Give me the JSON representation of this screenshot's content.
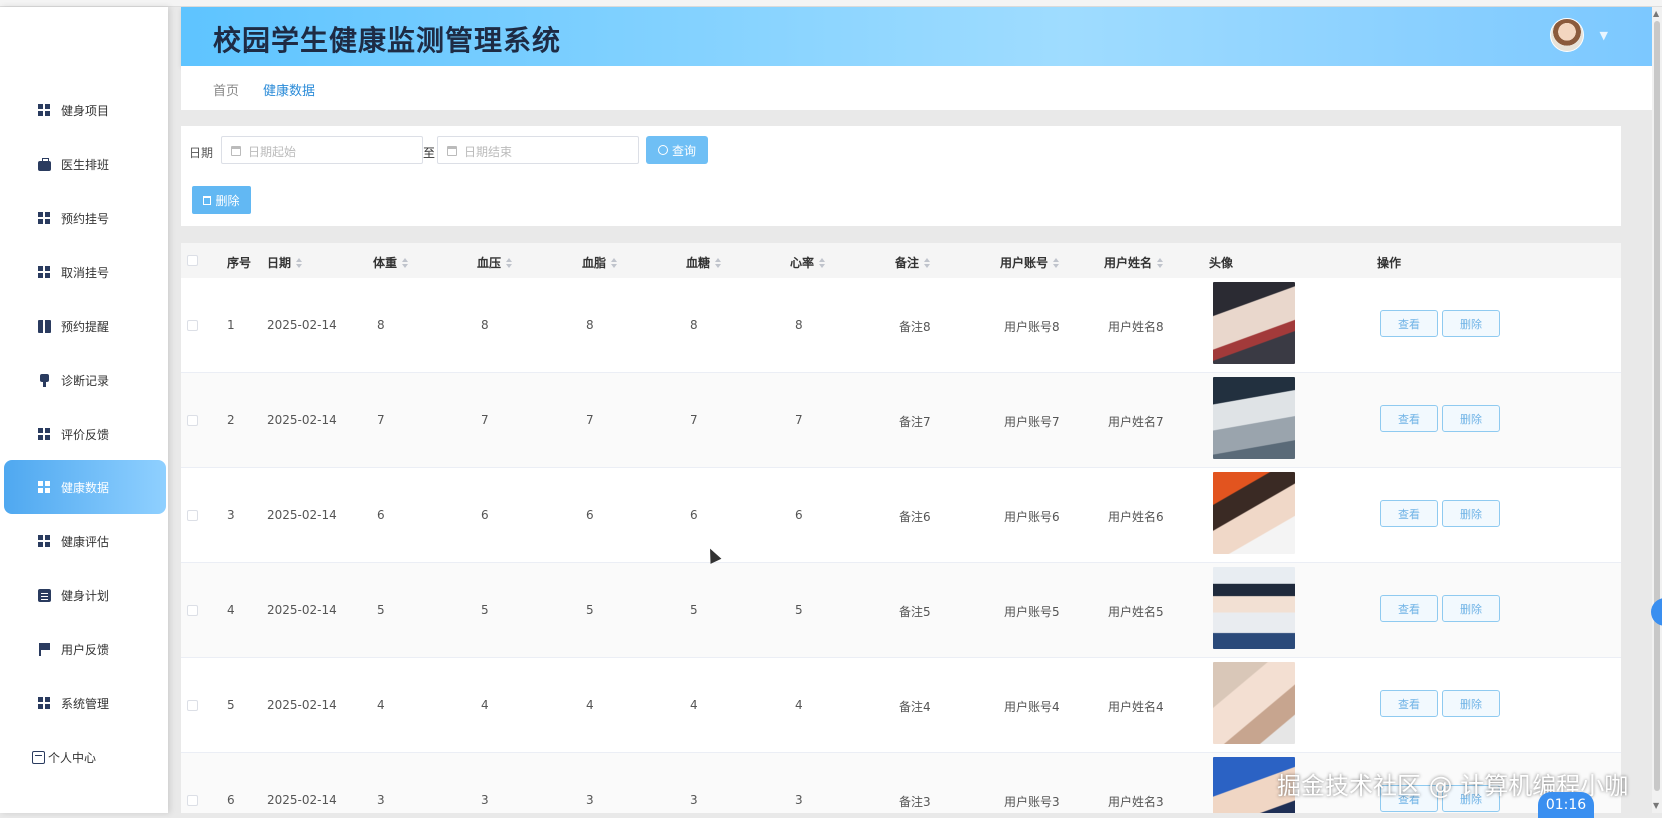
{
  "app": {
    "title": "校园学生健康监测管理系统"
  },
  "sidebar": {
    "items": [
      {
        "label": "健身项目",
        "icon": "grid-icon"
      },
      {
        "label": "医生排班",
        "icon": "briefcase-icon"
      },
      {
        "label": "预约挂号",
        "icon": "grid-icon"
      },
      {
        "label": "取消挂号",
        "icon": "grid-icon"
      },
      {
        "label": "预约提醒",
        "icon": "book-icon"
      },
      {
        "label": "诊断记录",
        "icon": "stamp-icon"
      },
      {
        "label": "评价反馈",
        "icon": "grid-icon"
      },
      {
        "label": "健康数据",
        "icon": "grid-icon",
        "active": true
      },
      {
        "label": "健康评估",
        "icon": "grid-icon"
      },
      {
        "label": "健身计划",
        "icon": "clipboard-icon"
      },
      {
        "label": "用户反馈",
        "icon": "flag-icon"
      },
      {
        "label": "系统管理",
        "icon": "grid-icon"
      }
    ],
    "personal": "个人中心"
  },
  "tabs": [
    {
      "label": "首页"
    },
    {
      "label": "健康数据",
      "active": true
    }
  ],
  "filter": {
    "date_label": "日期",
    "start_placeholder": "日期起始",
    "to_text": "至",
    "end_placeholder": "日期结束",
    "query_label": "查询",
    "batch_delete_label": "删除"
  },
  "table": {
    "headers": [
      "序号",
      "日期",
      "体重",
      "血压",
      "血脂",
      "血糖",
      "心率",
      "备注",
      "用户账号",
      "用户姓名",
      "头像",
      "操作"
    ],
    "rows": [
      {
        "index": "1",
        "date": "2025-02-14",
        "weight": "8",
        "bp": "8",
        "lipid": "8",
        "sugar": "8",
        "hr": "8",
        "note": "备注8",
        "account": "用户账号8",
        "name": "用户姓名8"
      },
      {
        "index": "2",
        "date": "2025-02-14",
        "weight": "7",
        "bp": "7",
        "lipid": "7",
        "sugar": "7",
        "hr": "7",
        "note": "备注7",
        "account": "用户账号7",
        "name": "用户姓名7"
      },
      {
        "index": "3",
        "date": "2025-02-14",
        "weight": "6",
        "bp": "6",
        "lipid": "6",
        "sugar": "6",
        "hr": "6",
        "note": "备注6",
        "account": "用户账号6",
        "name": "用户姓名6"
      },
      {
        "index": "4",
        "date": "2025-02-14",
        "weight": "5",
        "bp": "5",
        "lipid": "5",
        "sugar": "5",
        "hr": "5",
        "note": "备注5",
        "account": "用户账号5",
        "name": "用户姓名5"
      },
      {
        "index": "5",
        "date": "2025-02-14",
        "weight": "4",
        "bp": "4",
        "lipid": "4",
        "sugar": "4",
        "hr": "4",
        "note": "备注4",
        "account": "用户账号4",
        "name": "用户姓名4"
      },
      {
        "index": "6",
        "date": "2025-02-14",
        "weight": "3",
        "bp": "3",
        "lipid": "3",
        "sugar": "3",
        "hr": "3",
        "note": "备注3",
        "account": "用户账号3",
        "name": "用户姓名3"
      }
    ],
    "view_label": "查看",
    "delete_label": "删除"
  },
  "overlay": {
    "watermark": "掘金技术社区 @ 计算机编程小咖",
    "timer": "01:16"
  },
  "colors": {
    "header_start": "#5ec4ff",
    "active_menu": "#4fa8f0",
    "tab_active": "#2a8bd8",
    "button_primary": "#6fbff5"
  }
}
